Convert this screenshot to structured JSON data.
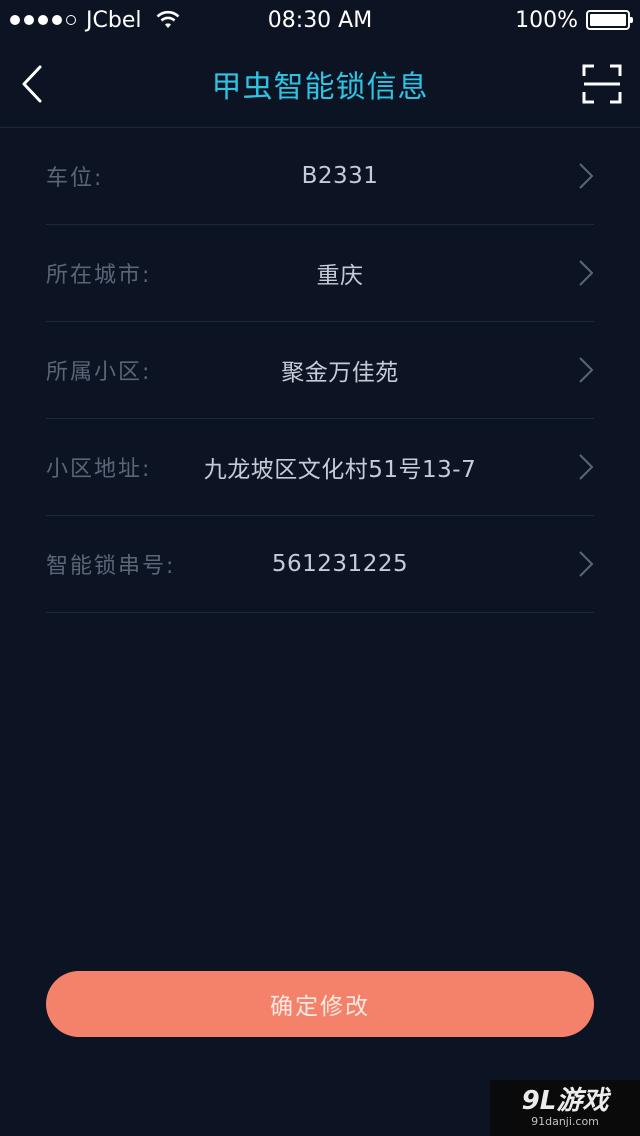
{
  "status_bar": {
    "carrier": "JCbel",
    "time": "08:30 AM",
    "battery": "100%"
  },
  "nav": {
    "title": "甲虫智能锁信息"
  },
  "info_rows": [
    {
      "label": "车位:",
      "value": "B2331"
    },
    {
      "label": "所在城市:",
      "value": "重庆"
    },
    {
      "label": "所属小区:",
      "value": "聚金万佳苑"
    },
    {
      "label": "小区地址:",
      "value": "九龙坡区文化村51号13-7"
    },
    {
      "label": "智能锁串号:",
      "value": "561231225"
    }
  ],
  "confirm_button": {
    "label": "确定修改"
  },
  "watermark": {
    "main": "9L游戏",
    "sub": "91danji.com"
  },
  "colors": {
    "background": "#0c1323",
    "title": "#2ec3e3",
    "button": "#f4826a"
  }
}
